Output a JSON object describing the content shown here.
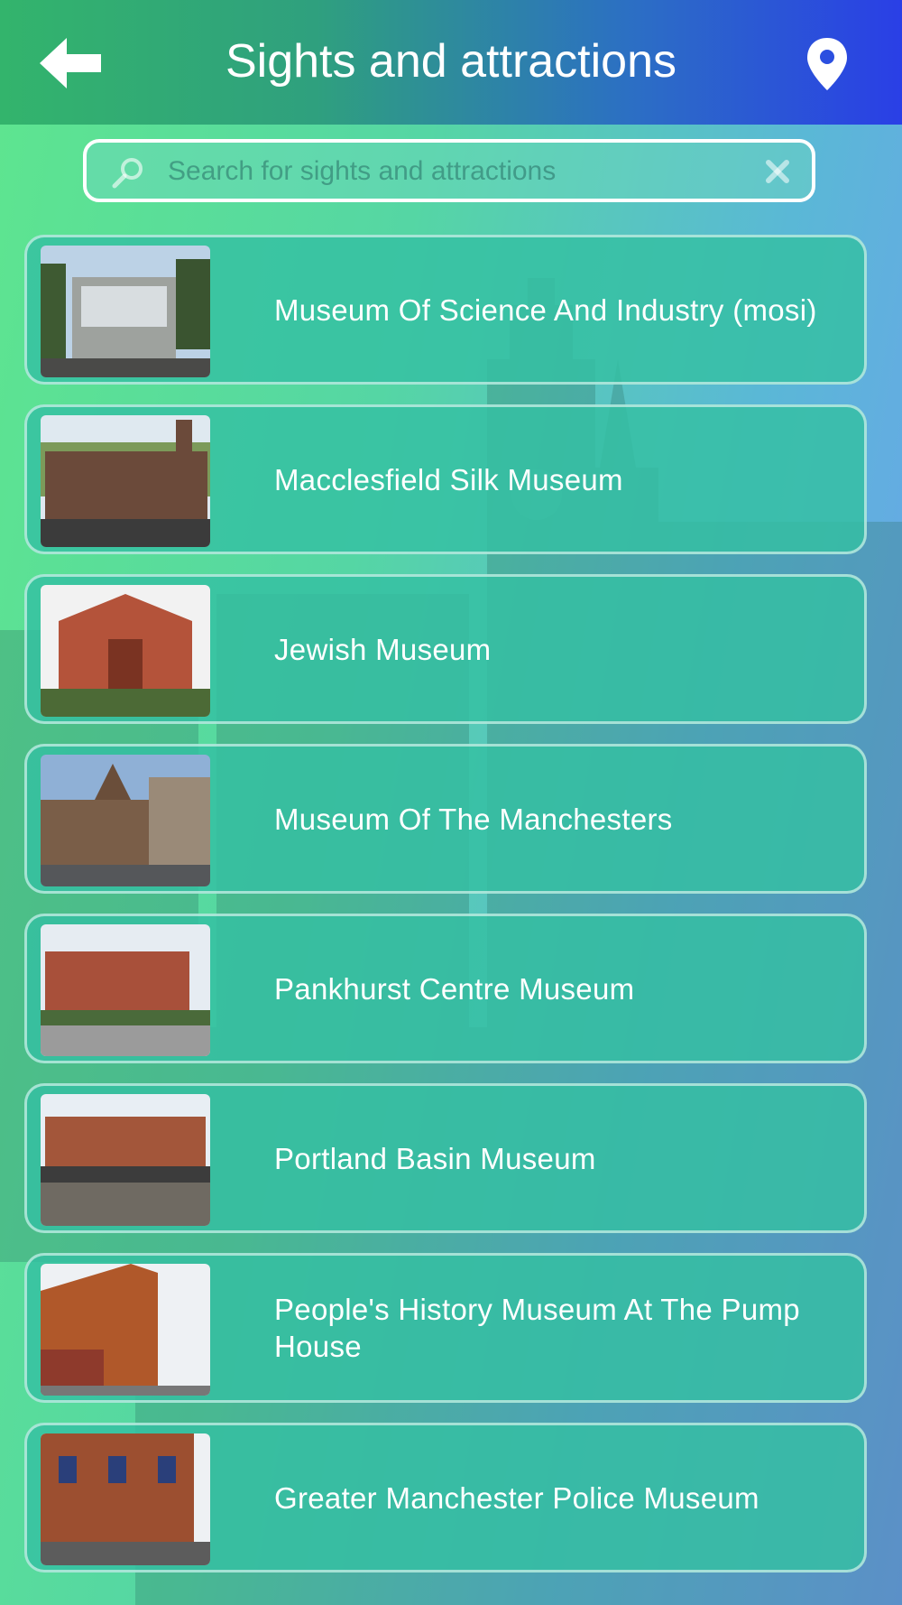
{
  "header": {
    "title": "Sights and attractions",
    "back_icon": "arrow-left-icon",
    "location_icon": "map-pin-icon"
  },
  "search": {
    "placeholder": "Search for sights and attractions",
    "value": "",
    "search_icon": "magnifier-icon",
    "clear_icon": "close-icon"
  },
  "items": [
    {
      "label": "Museum Of Science And Industry (mosi)"
    },
    {
      "label": "Macclesfield Silk Museum"
    },
    {
      "label": "Jewish Museum"
    },
    {
      "label": "Museum Of The Manchesters"
    },
    {
      "label": "Pankhurst Centre Museum"
    },
    {
      "label": "Portland Basin Museum"
    },
    {
      "label": "People's History Museum At The Pump House"
    },
    {
      "label": "Greater Manchester Police Museum"
    }
  ],
  "colors": {
    "header_left": "#33b46c",
    "header_right": "#2a3fe6",
    "item_bg": "#34c0a2",
    "text": "#ffffff"
  }
}
